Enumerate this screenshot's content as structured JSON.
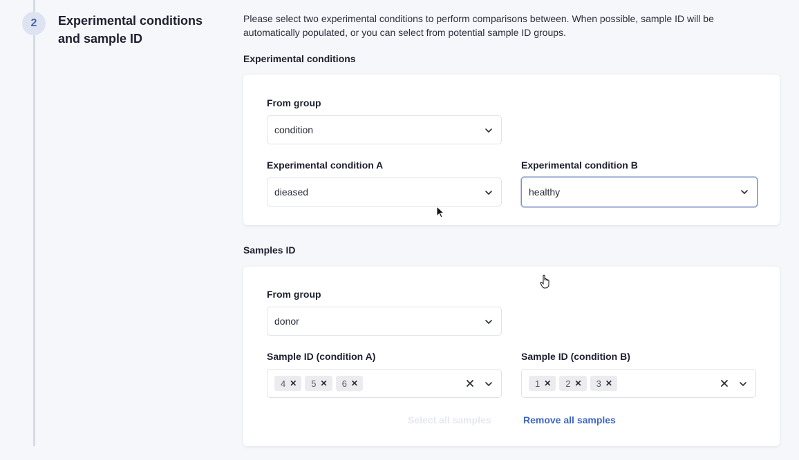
{
  "step": {
    "number": "2",
    "title": "Experimental conditions and sample ID",
    "description": "Please select two experimental conditions to perform comparisons between. When possible, sample ID will be automatically populated, or you can select from potential sample ID groups."
  },
  "experimental_conditions": {
    "section_label": "Experimental conditions",
    "from_group": {
      "label": "From group",
      "value": "condition"
    },
    "condition_a": {
      "label": "Experimental condition A",
      "value": "dieased"
    },
    "condition_b": {
      "label": "Experimental condition B",
      "value": "healthy"
    }
  },
  "samples": {
    "section_label": "Samples ID",
    "from_group": {
      "label": "From group",
      "value": "donor"
    },
    "sample_a": {
      "label": "Sample ID (condition A)",
      "chips": [
        "4",
        "5",
        "6"
      ]
    },
    "sample_b": {
      "label": "Sample ID (condition B)",
      "chips": [
        "1",
        "2",
        "3"
      ]
    },
    "select_all_label": "Select all samples",
    "remove_all_label": "Remove all samples"
  },
  "colors": {
    "accent": "#3f66c4",
    "badge_bg": "#dde3f1",
    "background": "#f6f7fb"
  }
}
